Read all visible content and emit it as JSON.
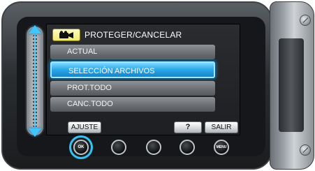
{
  "screen": {
    "header_title": "PROTEGER/CANCELAR",
    "header_icon": "movie-camera-icon"
  },
  "menu": {
    "items": [
      {
        "label": "ACTUAL",
        "state": "normal"
      },
      {
        "label": "SELECCIÓN ARCHIVOS",
        "state": "selected"
      },
      {
        "label": "PROT.TODO",
        "state": "normal"
      },
      {
        "label": "CANC.TODO",
        "state": "normal"
      }
    ]
  },
  "softkeys": {
    "ajuste": "AJUSTE",
    "help": "?",
    "salir": "SALIR"
  },
  "hardware_buttons": {
    "ok_label": "OK",
    "menu_label": "MENU"
  },
  "colors": {
    "highlight": "#2aa7e8",
    "accent_ring": "#35c2f5",
    "header_icon_bg": "#f2eb6a"
  }
}
